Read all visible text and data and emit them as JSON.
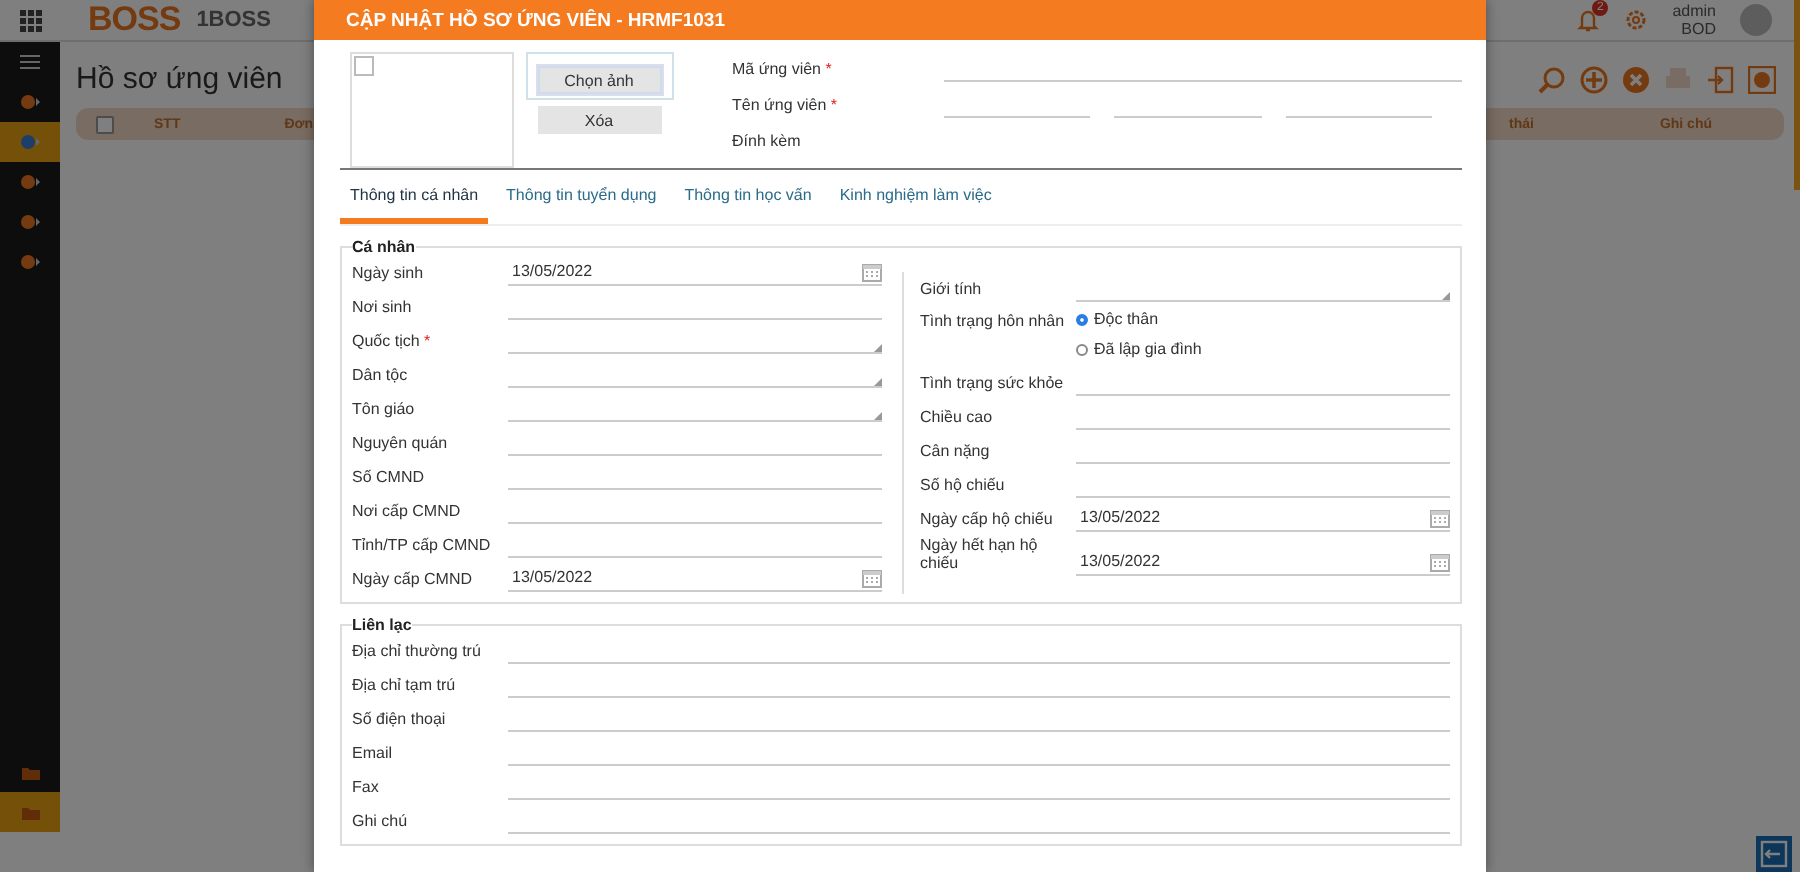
{
  "app": {
    "logo": "BOSS",
    "brand": "1BOSS",
    "notification_count": "2",
    "user": {
      "name": "admin",
      "role": "BOD"
    },
    "sidebar": {
      "items": [
        {
          "selected": false
        },
        {
          "selected": true
        },
        {
          "selected": false
        },
        {
          "selected": false
        },
        {
          "selected": false
        }
      ],
      "bottom_items": [
        {
          "selected": false
        },
        {
          "selected": true
        }
      ]
    },
    "page_title": "Hồ sơ ứng viên",
    "table": {
      "checkbox": {
        "checked": false
      },
      "columns": [
        "STT",
        "Đơn",
        "thái",
        "Ghi chú"
      ]
    }
  },
  "modal": {
    "title": "CẬP NHẬT HỒ SƠ ỨNG VIÊN - HRMF1031",
    "photo_checkbox": {
      "checked": false
    },
    "photo_buttons": [
      "Chọn ảnh",
      "Xóa"
    ],
    "header_fields": [
      {
        "label": "Mã ứng viên",
        "required_mark": "*",
        "kind": "text"
      },
      {
        "label": "Tên ứng viên",
        "required_mark": "*",
        "kind": "triple"
      },
      {
        "label": "Đính kèm",
        "kind": "attachment"
      }
    ],
    "tabs": [
      {
        "label": "Thông tin cá nhân",
        "selected": true
      },
      {
        "label": "Thông tin tuyển dụng",
        "selected": false
      },
      {
        "label": "Thông tin học vấn",
        "selected": false
      },
      {
        "label": "Kinh nghiệm làm việc",
        "selected": false
      }
    ],
    "sections": [
      {
        "title": "Cá nhân",
        "columns": [
          [
            {
              "label": "Ngày sinh",
              "kind": "date",
              "value": "13/05/2022"
            },
            {
              "label": "Nơi sinh",
              "kind": "text"
            },
            {
              "label": "Quốc tịch",
              "required_mark": "*",
              "kind": "select"
            },
            {
              "label": "Dân tộc",
              "kind": "select"
            },
            {
              "label": "Tôn giáo",
              "kind": "select"
            },
            {
              "label": "Nguyên quán",
              "kind": "text"
            },
            {
              "label": "Số CMND",
              "kind": "text"
            },
            {
              "label": "Nơi cấp CMND",
              "kind": "text"
            },
            {
              "label": "Tỉnh/TP cấp CMND",
              "kind": "text"
            },
            {
              "label": "Ngày cấp CMND",
              "kind": "date",
              "value": "13/05/2022"
            }
          ],
          [
            {
              "label": "Giới tính",
              "kind": "select"
            },
            {
              "label": "Tình trạng hôn nhân",
              "kind": "radio",
              "options": [
                {
                  "label": "Độc thân",
                  "selected": true
                },
                {
                  "label": "Đã lập gia đình",
                  "selected": false
                }
              ]
            },
            {
              "label": "Tình trạng sức khỏe",
              "kind": "text"
            },
            {
              "label": "Chiều cao",
              "kind": "text"
            },
            {
              "label": "Cân nặng",
              "kind": "text"
            },
            {
              "label": "Số hộ chiếu",
              "kind": "text"
            },
            {
              "label": "Ngày cấp hộ chiếu",
              "kind": "date",
              "value": "13/05/2022"
            },
            {
              "label": "Ngày hết hạn hộ chiếu",
              "kind": "date",
              "value": "13/05/2022"
            }
          ]
        ]
      },
      {
        "title": "Liên lạc",
        "columns": [
          [
            {
              "label": "Địa chỉ thường trú",
              "kind": "text"
            },
            {
              "label": "Địa chỉ tạm trú",
              "kind": "text"
            },
            {
              "label": "Số điện thoại",
              "kind": "text"
            },
            {
              "label": "Email",
              "kind": "text"
            },
            {
              "label": "Fax",
              "kind": "text"
            },
            {
              "label": "Ghi chú",
              "kind": "text"
            }
          ]
        ]
      }
    ]
  }
}
